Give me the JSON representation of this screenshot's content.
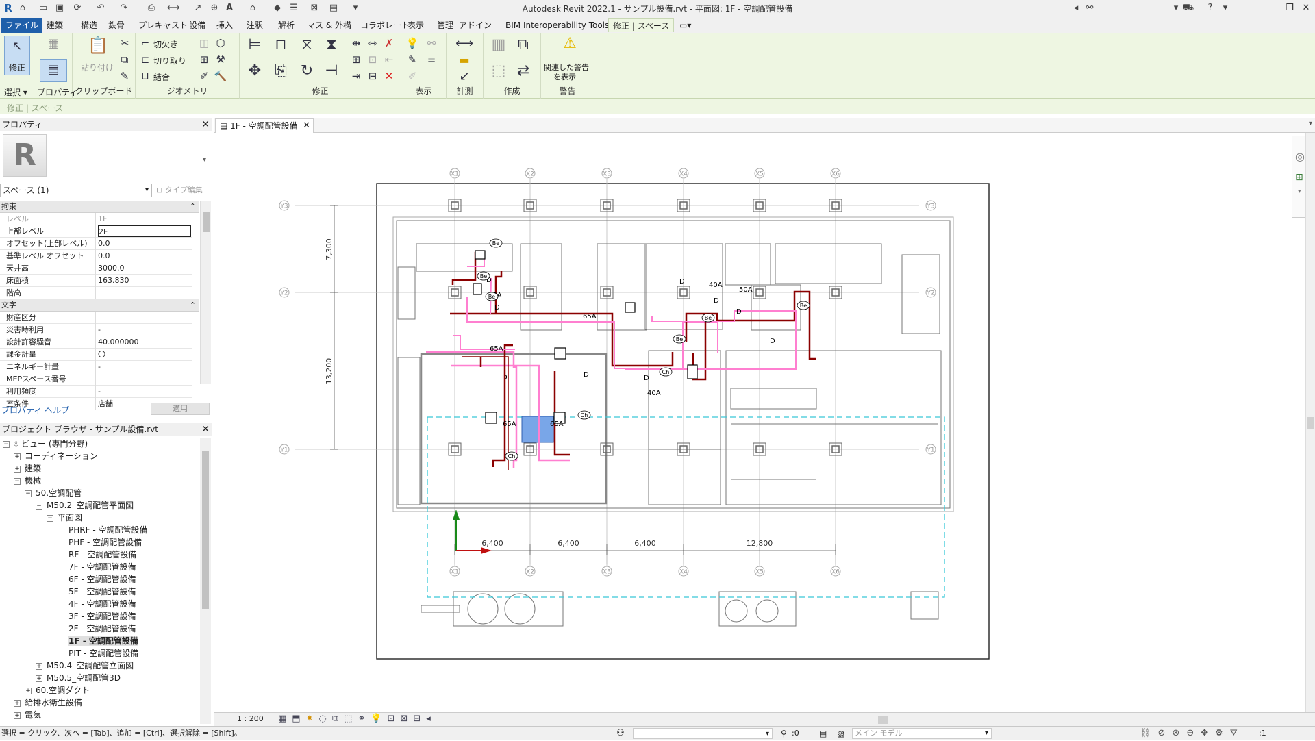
{
  "titlebar": {
    "title": "Autodesk Revit 2022.1 - サンプル設備.rvt - 平面図: 1F - 空調配管設備"
  },
  "tabs": [
    "ファイル",
    "建築",
    "構造",
    "鉄骨",
    "プレキャスト",
    "設備",
    "挿入",
    "注釈",
    "解析",
    "マス & 外構",
    "コラボレート",
    "表示",
    "管理",
    "アドイン",
    "BIM Interoperability Tools",
    "修正 | スペース"
  ],
  "ribbon": {
    "modify": "修正",
    "select": "選択 ▾",
    "properties": "プロパティ",
    "paste": "貼り付け",
    "clipboard": "クリップボード",
    "cut_ops": [
      "切欠き",
      "切り取り",
      "結合"
    ],
    "geometry": "ジオメトリ",
    "modify_group": "修正",
    "view_group": "表示",
    "measure": "計測",
    "create": "作成",
    "warnings_button": [
      "関連した警告",
      "を表示"
    ],
    "warnings": "警告"
  },
  "context_label": "修正 | スペース",
  "properties": {
    "title": "プロパティ",
    "type_selector": "スペース (1)",
    "type_edit": "タイプ編集",
    "cat1": "拘束",
    "rows1": [
      {
        "k": "レベル",
        "v": "1F"
      },
      {
        "k": "上部レベル",
        "v": "2F"
      },
      {
        "k": "オフセット(上部レベル)",
        "v": "0.0"
      },
      {
        "k": "基準レベル オフセット",
        "v": "0.0"
      },
      {
        "k": "天井高",
        "v": "3000.0"
      },
      {
        "k": "床面積",
        "v": "163.830"
      },
      {
        "k": "階高",
        "v": ""
      }
    ],
    "cat2": "文字",
    "rows2": [
      {
        "k": "財産区分",
        "v": ""
      },
      {
        "k": "災害時利用",
        "v": "-"
      },
      {
        "k": "設計許容騒音",
        "v": "40.000000"
      },
      {
        "k": "課金計量",
        "v": "〇"
      },
      {
        "k": "エネルギー計量",
        "v": "-"
      },
      {
        "k": "MEPスペース番号",
        "v": ""
      },
      {
        "k": "利用頻度",
        "v": "-"
      },
      {
        "k": "室条件",
        "v": "店舗"
      }
    ],
    "help": "プロパティ ヘルプ",
    "apply": "適用"
  },
  "browser": {
    "title": "プロジェクト ブラウザ - サンプル設備.rvt",
    "items": [
      {
        "t": "ビュー (専門分野)",
        "lvl": 0,
        "ex": "−",
        "icon": true
      },
      {
        "t": "コーディネーション",
        "lvl": 1,
        "ex": "+"
      },
      {
        "t": "建築",
        "lvl": 1,
        "ex": "+"
      },
      {
        "t": "機械",
        "lvl": 1,
        "ex": "−"
      },
      {
        "t": "50.空調配管",
        "lvl": 2,
        "ex": "−"
      },
      {
        "t": "M50.2_空調配管平面図",
        "lvl": 3,
        "ex": "−"
      },
      {
        "t": "平面図",
        "lvl": 4,
        "ex": "−"
      },
      {
        "t": "PHRF - 空調配管設備",
        "lvl": 5
      },
      {
        "t": "PHF - 空調配管設備",
        "lvl": 5
      },
      {
        "t": "RF - 空調配管設備",
        "lvl": 5
      },
      {
        "t": "7F - 空調配管設備",
        "lvl": 5
      },
      {
        "t": "6F - 空調配管設備",
        "lvl": 5
      },
      {
        "t": "5F - 空調配管設備",
        "lvl": 5
      },
      {
        "t": "4F - 空調配管設備",
        "lvl": 5
      },
      {
        "t": "3F - 空調配管設備",
        "lvl": 5
      },
      {
        "t": "2F - 空調配管設備",
        "lvl": 5
      },
      {
        "t": "1F - 空調配管設備",
        "lvl": 5,
        "bold": true
      },
      {
        "t": "PIT - 空調配管設備",
        "lvl": 5
      },
      {
        "t": "M50.4_空調配管立面図",
        "lvl": 3,
        "ex": "+"
      },
      {
        "t": "M50.5_空調配管3D",
        "lvl": 3,
        "ex": "+"
      },
      {
        "t": "60.空調ダクト",
        "lvl": 2,
        "ex": "+"
      },
      {
        "t": "給排水衛生設備",
        "lvl": 1,
        "ex": "+"
      },
      {
        "t": "電気",
        "lvl": 1,
        "ex": "+"
      }
    ]
  },
  "view_tab": "1F - 空調配管設備",
  "drawing": {
    "grid_x": [
      "X1",
      "X2",
      "X3",
      "X4",
      "X5",
      "X6"
    ],
    "grid_y": [
      "Y3",
      "Y2",
      "Y1"
    ],
    "dims_x": [
      "6,400",
      "6,400",
      "6,400",
      "12,800"
    ],
    "dims_y": [
      "7,300",
      "13,200"
    ],
    "pipe_labels": [
      "65A",
      "65A",
      "65A",
      "65A",
      "65A",
      "40A",
      "50A",
      "40A"
    ],
    "tags_be": "Be",
    "tags_ch": "Ch",
    "d_mark": "D"
  },
  "viewbar": {
    "scale": "1 : 200"
  },
  "status": {
    "text": "選択 = クリック、次へ = [Tab]、追加 = [Ctrl]、選択解除 = [Shift]。",
    "count": ":0",
    "model": "メイン モデル",
    "filter": ":1"
  },
  "colors": {
    "ribbon": "#eef6e2",
    "pipe_red": "#8b0000",
    "pipe_pink": "#ff7fd0",
    "space_blue": "#79a6e8",
    "accent": "#1f5faa"
  }
}
